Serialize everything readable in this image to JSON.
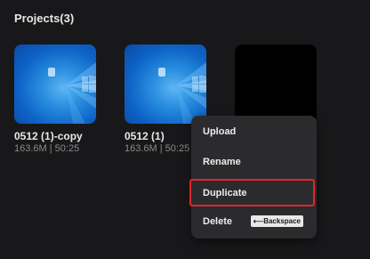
{
  "header": {
    "title": "Projects(3)"
  },
  "projects": [
    {
      "name": "0512 (1)-copy",
      "meta": "163.6M | 50:25",
      "thumbnail": "windows-wallpaper"
    },
    {
      "name": "0512 (1)",
      "meta": "163.6M | 50:25",
      "thumbnail": "windows-wallpaper"
    },
    {
      "name": "",
      "meta": "",
      "thumbnail": "black"
    }
  ],
  "context_menu": {
    "items": [
      {
        "label": "Upload"
      },
      {
        "label": "Rename"
      },
      {
        "label": "Duplicate",
        "highlighted": true
      },
      {
        "label": "Delete",
        "shortcut": "⟵Backspace"
      }
    ]
  },
  "colors": {
    "background": "#18181a",
    "menu_background": "#2b2b2e",
    "highlight_border": "#e0262b",
    "meta_text": "#8a8a8a"
  }
}
